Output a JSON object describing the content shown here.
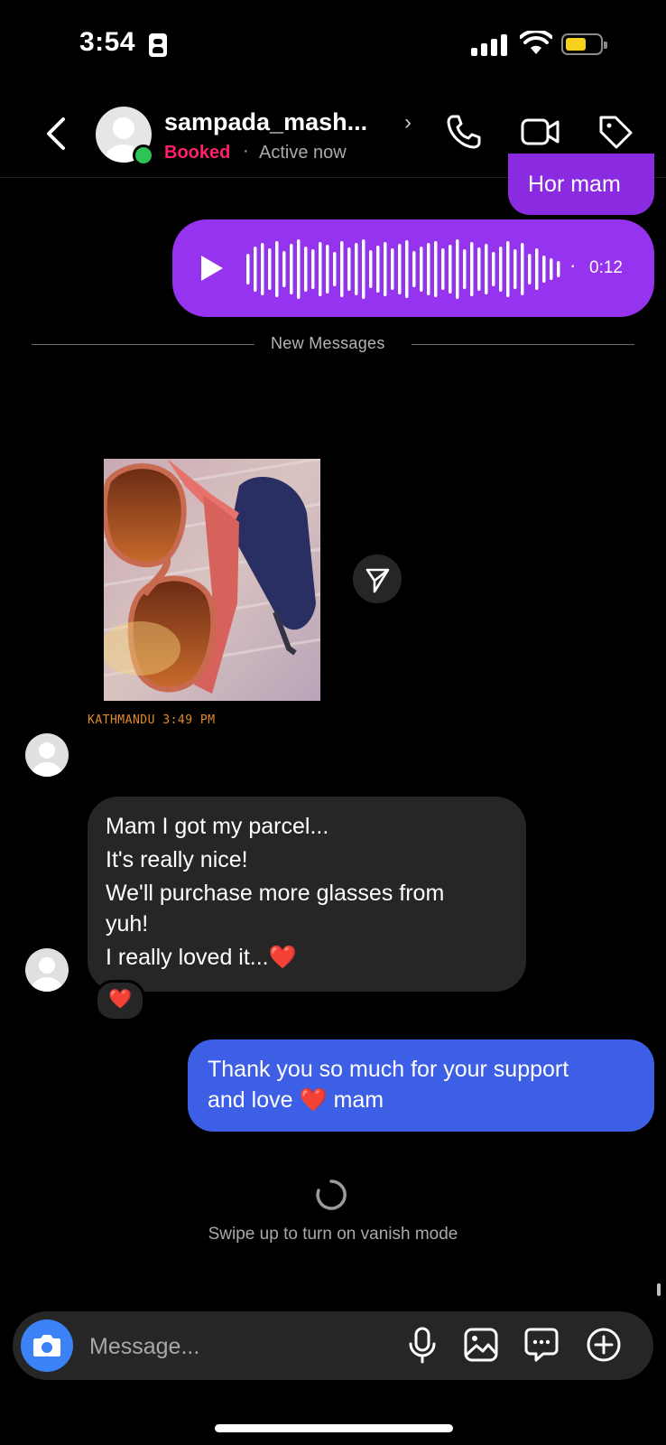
{
  "status_bar": {
    "time": "3:54"
  },
  "header": {
    "username": "sampada_mash...",
    "label": "Booked",
    "separator": "·",
    "activity": "Active now",
    "icons": [
      "back-arrow-icon",
      "phone-icon",
      "video-camera-icon",
      "tag-icon"
    ]
  },
  "messages": {
    "sent_top": "Hor mam",
    "voice_note": {
      "duration": "0:12",
      "dot": "·"
    },
    "divider": "New Messages",
    "photo_stamp": "KATHMANDU 3:49 PM",
    "received_lines": [
      "Mam I got my parcel...",
      "It's really nice!",
      "We'll purchase more glasses from",
      "yuh!",
      "I really loved it..."
    ],
    "received_emoji": "❤️",
    "reaction": "❤️",
    "sent_line1": "Thank you so much for your support",
    "sent_line2_a": "and love",
    "sent_line2_emoji": "❤️",
    "sent_line2_b": "mam"
  },
  "vanish_hint": "Swipe up to turn on vanish mode",
  "composer": {
    "placeholder": "Message...",
    "icons": [
      "camera-icon",
      "microphone-icon",
      "gallery-icon",
      "sticker-chat-icon",
      "plus-icon"
    ]
  },
  "colors": {
    "sent_purple": "#8a2be2",
    "sent_blue": "#3d5fe6",
    "received_gray": "#262626",
    "booked_pink": "#ff1f6b",
    "online_green": "#2ec455"
  }
}
